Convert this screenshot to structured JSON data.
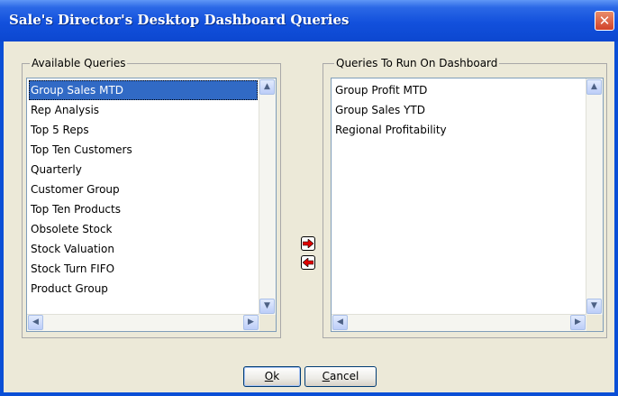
{
  "window": {
    "title": "Sale's Director's Desktop Dashboard Queries"
  },
  "available": {
    "legend": "Available Queries",
    "items": [
      "Group Sales MTD",
      "Rep Analysis",
      "Top 5 Reps",
      "Top Ten Customers",
      "Quarterly",
      "Customer Group",
      "Top Ten Products",
      "Obsolete Stock",
      "Stock Valuation",
      "Stock Turn FIFO",
      "Product Group"
    ],
    "selected_index": 0
  },
  "dashboard": {
    "legend": "Queries To Run On Dashboard",
    "items": [
      "Group Profit MTD",
      "Group Sales YTD",
      "Regional Profitability"
    ]
  },
  "buttons": {
    "ok_mnemonic": "O",
    "ok_rest": "k",
    "cancel_mnemonic": "C",
    "cancel_rest": "ancel"
  },
  "icons": {
    "close": "close-icon",
    "move_right": "arrow-right-icon",
    "move_left": "arrow-left-icon",
    "arrow_color": "#e00000"
  }
}
